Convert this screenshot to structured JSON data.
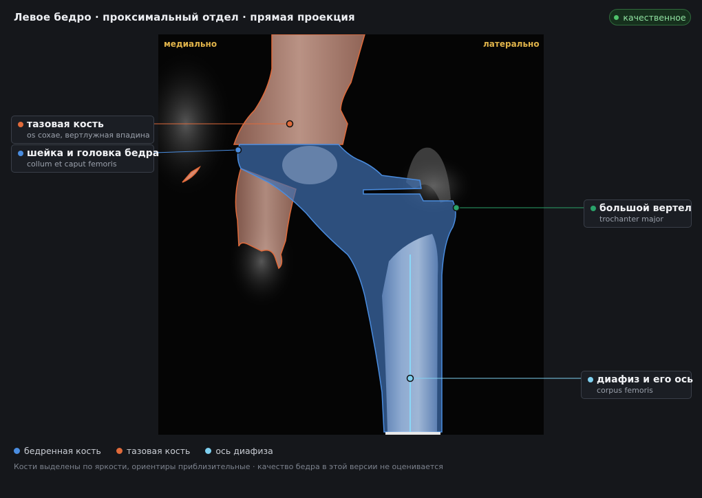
{
  "header": {
    "title": "Левое бедро · проксимальный отдел · прямая проекция",
    "badge": "качественное"
  },
  "viewer": {
    "orientation_left": "медиально",
    "orientation_right": "латерально"
  },
  "annotations": [
    {
      "id": "pelvis",
      "title": "тазовая кость",
      "subtitle": "os coxae, вертлужная впадина",
      "color": "#e06a3a"
    },
    {
      "id": "neck",
      "title": "шейка и головка бедра",
      "subtitle": "collum et caput femoris",
      "color": "#4a8de0"
    },
    {
      "id": "trochanter",
      "title": "большой вертел",
      "subtitle": "trochanter major",
      "color": "#2aa36a"
    },
    {
      "id": "shaft",
      "title": "диафиз и его ось",
      "subtitle": "corpus femoris",
      "color": "#7fd0f0"
    }
  ],
  "legend": [
    {
      "label": "бедренная кость",
      "color": "#4a8de0"
    },
    {
      "label": "тазовая кость",
      "color": "#e06a3a"
    },
    {
      "label": "ось диафиза",
      "color": "#7fd0f0"
    }
  ],
  "footnote": "Кости выделены по яркости, ориентиры приблизительные · качество бедра в этой версии не оценивается"
}
